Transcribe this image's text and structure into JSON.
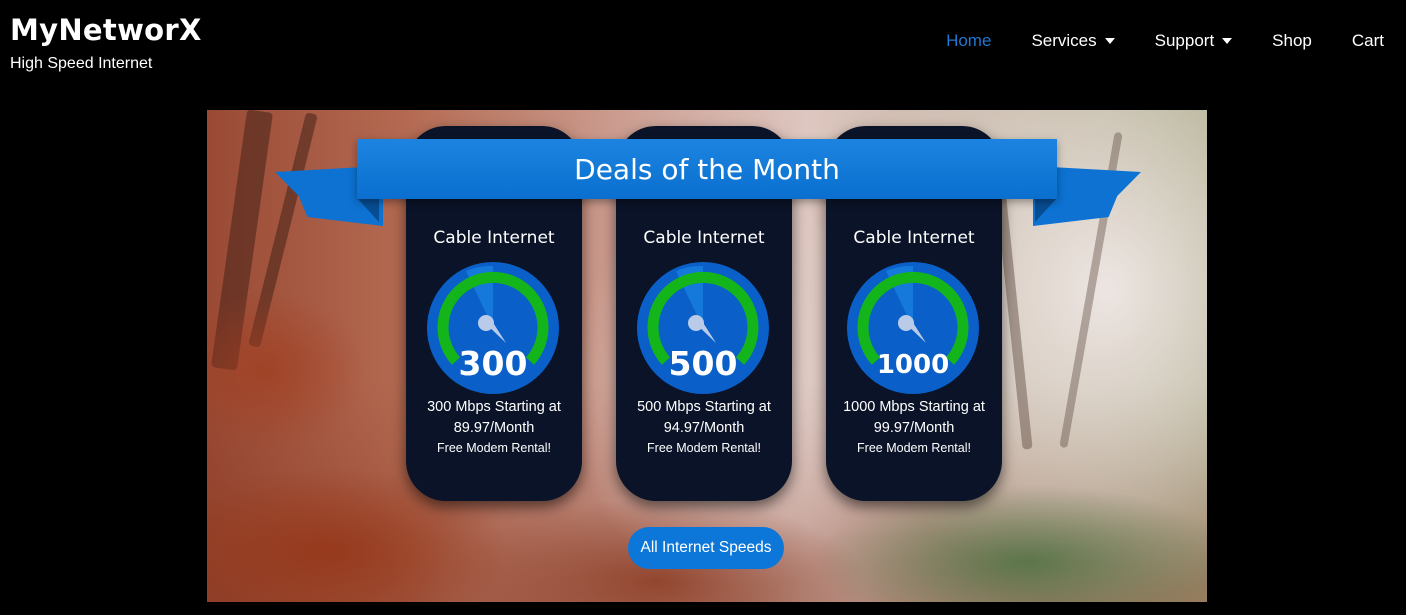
{
  "brand": {
    "title": "MyNetworX",
    "subtitle": "High Speed Internet"
  },
  "nav": {
    "items": [
      {
        "label": "Home",
        "active": true,
        "dropdown": false
      },
      {
        "label": "Services",
        "active": false,
        "dropdown": true
      },
      {
        "label": "Support",
        "active": false,
        "dropdown": true
      },
      {
        "label": "Shop",
        "active": false,
        "dropdown": false
      },
      {
        "label": "Cart",
        "active": false,
        "dropdown": false
      }
    ],
    "active_color": "#1f77d0"
  },
  "hero": {
    "banner": "Deals of the Month",
    "cards": [
      {
        "title": "Cable Internet",
        "speed": "300",
        "price_line1": "300 Mbps Starting at",
        "price_line2": "89.97/Month",
        "note": "Free Modem Rental!"
      },
      {
        "title": "Cable Internet",
        "speed": "500",
        "price_line1": "500 Mbps Starting at",
        "price_line2": "94.97/Month",
        "note": "Free Modem Rental!"
      },
      {
        "title": "Cable Internet",
        "speed": "1000",
        "price_line1": "1000 Mbps Starting at",
        "price_line2": "99.97/Month",
        "note": "Free Modem Rental!"
      }
    ],
    "cta_label": "All Internet Speeds"
  },
  "colors": {
    "accent_blue": "#0c77d8",
    "card_bg": "#0b1328",
    "gauge_green": "#14b51a"
  },
  "icons": {
    "gauge": "speedometer-icon",
    "caret": "caret-down-icon"
  }
}
